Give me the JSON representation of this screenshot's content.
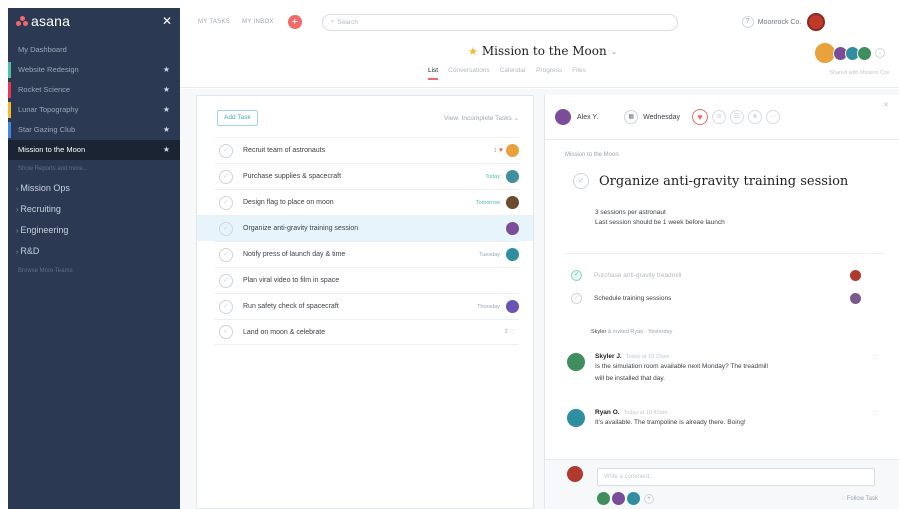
{
  "app": {
    "logo": "asana",
    "close": "✕"
  },
  "colors": {
    "accent": "#f06a6a",
    "sidebar_bg": "#2b3a52",
    "star": "#f5b829",
    "teal": "#48aab4"
  },
  "sidebar": {
    "items": [
      {
        "label": "My Dashboard",
        "bar": "",
        "star": false
      },
      {
        "label": "Website Redesign",
        "bar": "#4ec1a8",
        "star": true
      },
      {
        "label": "Rocket Science",
        "bar": "#e8384f",
        "star": true
      },
      {
        "label": "Lunar Topography",
        "bar": "#f5b829",
        "star": true
      },
      {
        "label": "Star Gazing Club",
        "bar": "#4186e0",
        "star": true
      },
      {
        "label": "Mission to the Moon",
        "bar": "",
        "star": true,
        "active": true
      }
    ],
    "show_more": "Show Reports and more...",
    "teams": [
      "Mission Ops",
      "Recruiting",
      "Engineering",
      "R&D"
    ],
    "browse": "Browse More Teams"
  },
  "topbar": {
    "my_tasks": "MY TASKS",
    "my_inbox": "MY INBOX",
    "search_placeholder": "Search",
    "org": "Moonrock Co."
  },
  "project": {
    "name": "Mission to the Moon",
    "tabs": [
      "List",
      "Conversations",
      "Calendar",
      "Progress",
      "Files"
    ],
    "members_label": "Shared with Mission Cre"
  },
  "list": {
    "add_task": "Add Task",
    "view_filter": "View: Incomplete Tasks",
    "tasks": [
      {
        "name": "Recruit team of astronauts",
        "due": "",
        "due_color": "",
        "likes": "1",
        "heart": true,
        "avatar": "#e9a23b"
      },
      {
        "name": "Purchase supplies & spacecraft",
        "due": "Today",
        "due_color": "#4ec1a8",
        "avatar": "#3f8f9e"
      },
      {
        "name": "Design flag to place on moon",
        "due": "Tomorrow",
        "due_color": "#4ec1a8",
        "avatar": "#6b4a2e"
      },
      {
        "name": "Organize anti-gravity training session",
        "due": "",
        "due_color": "",
        "avatar": "#7a4c9a",
        "selected": true
      },
      {
        "name": "Notify press of launch day & time",
        "due": "Tuesday",
        "due_color": "#9ca6af",
        "avatar": "#2f8fa0"
      },
      {
        "name": "Plan viral video to film in space",
        "due": "",
        "due_color": "",
        "avatar": ""
      },
      {
        "name": "Run safety check of spacecraft",
        "due": "Thursday",
        "due_color": "#9ca6af",
        "avatar": "#6a55b5"
      },
      {
        "name": "Land on moon & celebrate",
        "due": "",
        "due_color": "",
        "likes": "2",
        "avatar": ""
      }
    ]
  },
  "detail": {
    "assignee": "Alex Y.",
    "due_date": "Wednesday",
    "project": "Mission to the Moon",
    "title": "Organize anti-gravity training session",
    "description": [
      "3 sessions per astronaut",
      "Last session should be 1 week before launch"
    ],
    "subtasks": [
      {
        "name": "Purchase anti-gravity treadmill",
        "done": true,
        "avatar": "#b03a2e"
      },
      {
        "name": "Schedule training sessions",
        "done": false,
        "avatar": "#7a5a8a"
      }
    ],
    "activity": {
      "who": "Skyler",
      "rest": "& invited Ryan",
      "when": "Yesterday"
    },
    "comments": [
      {
        "name": "Skyler J.",
        "time": "Today at 10:23am",
        "text": [
          "Is the simulation room available next Monday? The treadmill",
          "will be installed that day."
        ],
        "avatar": "#3f8f5e"
      },
      {
        "name": "Ryan O.",
        "time": "Today at 10:42am",
        "text": [
          "It's available. The trampoline is already there. Boing!"
        ],
        "avatar": "#2f8fa0"
      }
    ],
    "comment_placeholder": "Write a comment...",
    "follow": "Follow Task"
  }
}
